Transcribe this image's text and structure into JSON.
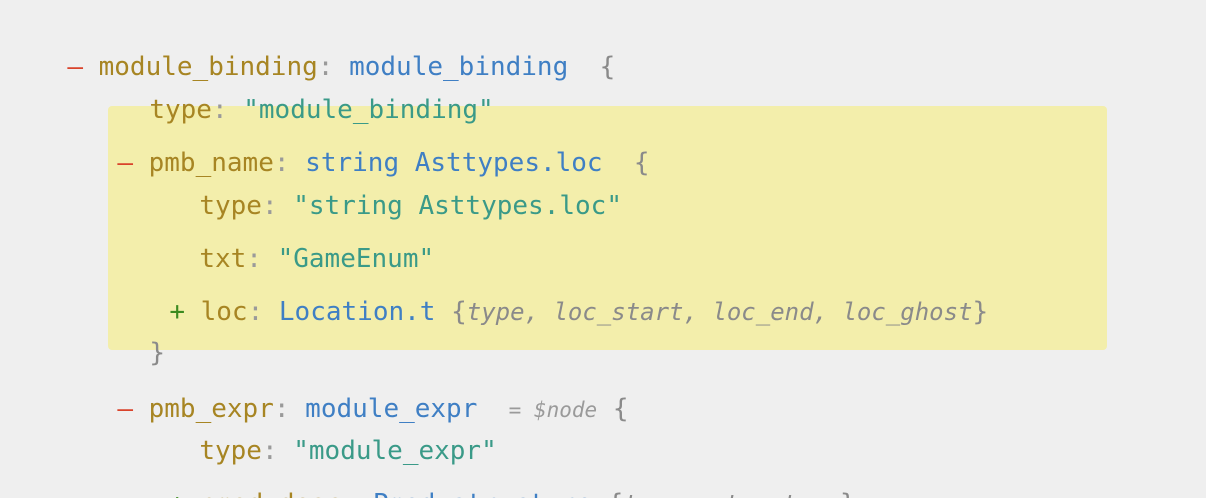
{
  "tree": {
    "root": {
      "toggle": "–",
      "key": "module_binding",
      "type": "module_binding",
      "open_brace": "{",
      "type_field": {
        "key": "type",
        "value": "\"module_binding\""
      }
    },
    "pmb_name": {
      "toggle": "–",
      "key": "pmb_name",
      "type": "string Asttypes.loc",
      "open_brace": "{",
      "type_field": {
        "key": "type",
        "value": "\"string Asttypes.loc\""
      },
      "txt_field": {
        "key": "txt",
        "value": "\"GameEnum\""
      },
      "loc_field": {
        "toggle": "+",
        "key": "loc",
        "type": "Location.t",
        "open": "{",
        "summary": "type, loc_start, loc_end, loc_ghost",
        "close": "}"
      },
      "close_brace": "}"
    },
    "pmb_expr": {
      "toggle": "–",
      "key": "pmb_expr",
      "type": "module_expr",
      "node_ref": "= $node",
      "open_brace": "{",
      "type_field": {
        "key": "type",
        "value": "\"module_expr\""
      },
      "pmod_desc_field": {
        "toggle": "+",
        "key": "pmod_desc",
        "type": "Pmod_structure",
        "open": "{",
        "summary": "type, structure",
        "close": "}"
      }
    }
  },
  "colors": {
    "background": "#efefef",
    "highlight": "#f3eeab",
    "key": "#a78523",
    "type": "#3f7fc4",
    "string": "#3a9a88",
    "minus_toggle": "#d9432b",
    "plus_toggle": "#3b8a1f"
  }
}
